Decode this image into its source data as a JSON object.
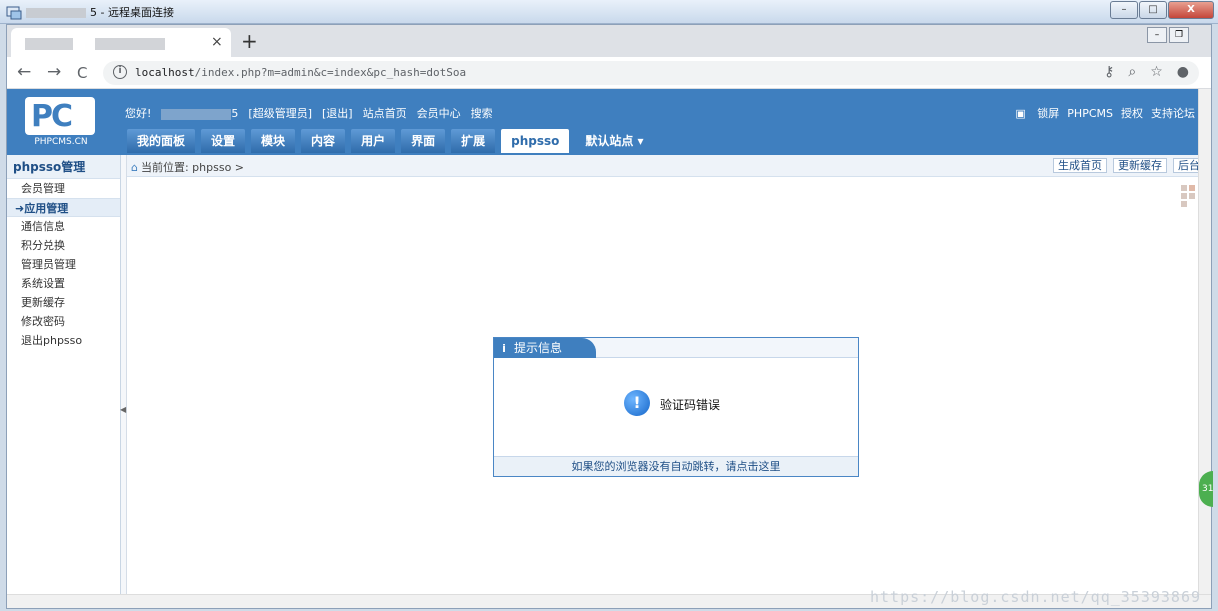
{
  "window": {
    "title_suffix": "5 - 远程桌面连接",
    "buttons": {
      "minimize": "–",
      "restore": "□",
      "close": "X"
    }
  },
  "browser": {
    "tab_close": "×",
    "new_tab": "+",
    "nav": {
      "back": "←",
      "forward": "→",
      "reload": "C"
    },
    "url_host": "localhost",
    "url_rest": "/index.php?m=admin&c=index&pc_hash=dotSoa",
    "icons": {
      "key": "⚷",
      "zoom": "⌕",
      "star": "☆",
      "profile": "●"
    }
  },
  "header": {
    "logo_text": "PC",
    "logo_brand": "PHPCMS.CN",
    "toplinks": {
      "greeting": "您好!",
      "name_suffix": "5",
      "role": "[超级管理员]",
      "logout": "[退出]",
      "site_home": "站点首页",
      "member_center": "会员中心",
      "search": "搜索"
    },
    "topright": {
      "lock": "锁屏",
      "phpcms": "PHPCMS",
      "license": "授权",
      "forum": "支持论坛"
    },
    "nav": [
      "我的面板",
      "设置",
      "模块",
      "内容",
      "用户",
      "界面",
      "扩展",
      "phpsso"
    ],
    "site_select": "默认站点 ▾"
  },
  "sidebar": {
    "title": "phpsso管理",
    "items": [
      "会员管理",
      "应用管理",
      "通信信息",
      "积分兑换",
      "管理员管理",
      "系统设置",
      "更新缓存",
      "修改密码",
      "退出phpsso"
    ],
    "active_prefix": "➜"
  },
  "breadcrumb": {
    "label": "当前位置: phpsso >",
    "buttons": [
      "生成首页",
      "更新缓存",
      "后台"
    ]
  },
  "dialog": {
    "title": "提示信息",
    "icon": "i",
    "message": "验证码错误",
    "footer_link": "如果您的浏览器没有自动跳转，请点击这里",
    "warn_glyph": "!"
  },
  "watermark": "https://blog.csdn.net/qq_35393869",
  "badge": "31"
}
